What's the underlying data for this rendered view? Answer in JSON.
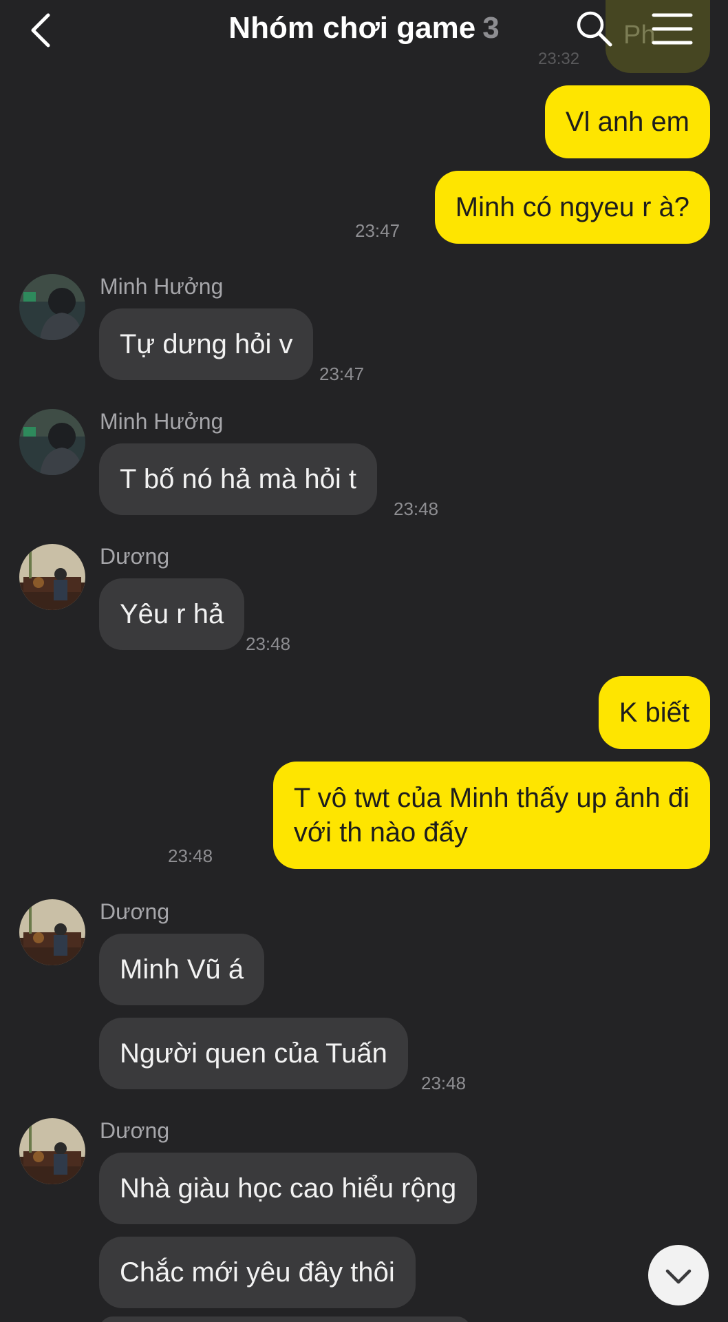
{
  "header": {
    "title": "Nhóm chơi game",
    "member_count": "3"
  },
  "previous_message": {
    "text": "Ph",
    "time": "23:32"
  },
  "messages": [
    {
      "side": "me",
      "text": "Vl anh em"
    },
    {
      "side": "me",
      "text": "Minh có ngyeu r à?",
      "time": "23:47"
    },
    {
      "side": "them",
      "sender": "Minh Hưởng",
      "text": "Tự dưng hỏi v",
      "time": "23:47"
    },
    {
      "side": "them",
      "sender": "Minh Hưởng",
      "text": "T bố nó hả mà hỏi t",
      "time": "23:48"
    },
    {
      "side": "them",
      "sender": "Dương",
      "text": "Yêu r hả",
      "time": "23:48"
    },
    {
      "side": "me",
      "text": "K biết"
    },
    {
      "side": "me",
      "line1": "T vô twt của Minh thấy up ảnh đi",
      "line2": "với th nào đấy",
      "time": "23:48"
    },
    {
      "side": "them",
      "sender": "Dương",
      "text": "Minh Vũ á"
    },
    {
      "side": "them",
      "text": "Người quen của Tuấn",
      "time": "23:48"
    },
    {
      "side": "them",
      "sender": "Dương",
      "text": "Nhà giàu học cao hiểu rộng"
    },
    {
      "side": "them",
      "text": "Chắc mới yêu đây thôi"
    }
  ],
  "icons": {
    "back": "chevron-left-icon",
    "search": "search-icon",
    "menu": "hamburger-menu-icon",
    "scroll": "chevron-down-icon"
  },
  "colors": {
    "background": "#232325",
    "my_bubble": "#fee500",
    "their_bubble": "#3a3a3c",
    "timestamp": "#8e8e92"
  }
}
